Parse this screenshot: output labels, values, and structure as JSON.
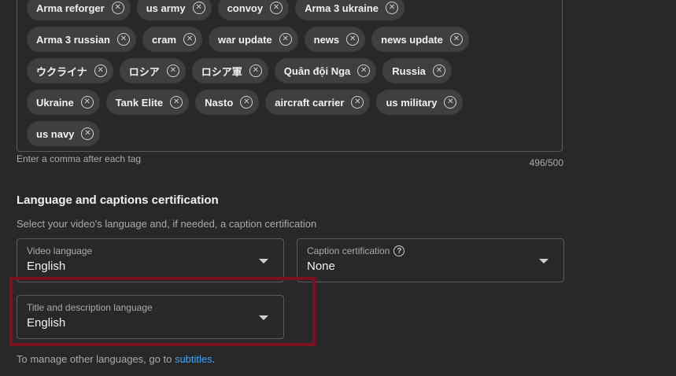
{
  "tags": {
    "rows": [
      [
        "Arma reforger",
        "us army",
        "convoy",
        "Arma 3 ukraine"
      ],
      [
        "Arma 3 russian",
        "cram",
        "war update",
        "news",
        "news update"
      ],
      [
        "ウクライナ",
        "ロシア",
        "ロシア軍",
        "Quân đội Nga",
        "Russia"
      ],
      [
        "Ukraine",
        "Tank Elite",
        "Nasto",
        "aircraft carrier",
        "us military"
      ],
      [
        "us navy"
      ]
    ],
    "hint": "Enter a comma after each tag",
    "counter": "496/500",
    "remove_glyph": "✕"
  },
  "language_section": {
    "title": "Language and captions certification",
    "subtitle": "Select your video's language and, if needed, a caption certification",
    "video_language": {
      "label": "Video language",
      "value": "English"
    },
    "caption_certification": {
      "label": "Caption certification",
      "value": "None",
      "help_glyph": "?"
    },
    "title_description_language": {
      "label": "Title and description language",
      "value": "English"
    }
  },
  "footer": {
    "text": "To manage other languages, go to ",
    "link": "subtitles",
    "suffix": "."
  },
  "colors": {
    "background": "#282828",
    "chip": "#3f3f3f",
    "link": "#3ea6ff",
    "highlight": "#7b1020"
  }
}
